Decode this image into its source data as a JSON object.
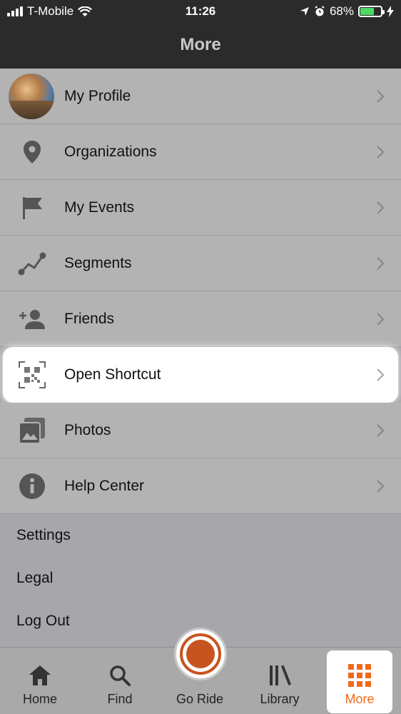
{
  "status_bar": {
    "carrier": "T-Mobile",
    "time": "11:26",
    "battery_percent": "68%",
    "battery_level": 0.68,
    "battery_color": "#4cd964"
  },
  "header": {
    "title": "More"
  },
  "menu": {
    "items": [
      {
        "label": "My Profile",
        "icon": "avatar"
      },
      {
        "label": "Organizations",
        "icon": "location-pin-icon"
      },
      {
        "label": "My Events",
        "icon": "flag-icon"
      },
      {
        "label": "Segments",
        "icon": "segments-icon"
      },
      {
        "label": "Friends",
        "icon": "add-friend-icon"
      },
      {
        "label": "Open Shortcut",
        "icon": "qr-code-icon",
        "highlighted": true
      },
      {
        "label": "Photos",
        "icon": "photos-icon"
      },
      {
        "label": "Help Center",
        "icon": "info-icon"
      }
    ]
  },
  "secondary": {
    "settings": "Settings",
    "legal": "Legal",
    "logout": "Log Out"
  },
  "tabbar": {
    "home": "Home",
    "find": "Find",
    "goride": "Go Ride",
    "library": "Library",
    "more": "More",
    "active": "more",
    "accent_color": "#f06a1a",
    "record_color": "#c7541f"
  }
}
